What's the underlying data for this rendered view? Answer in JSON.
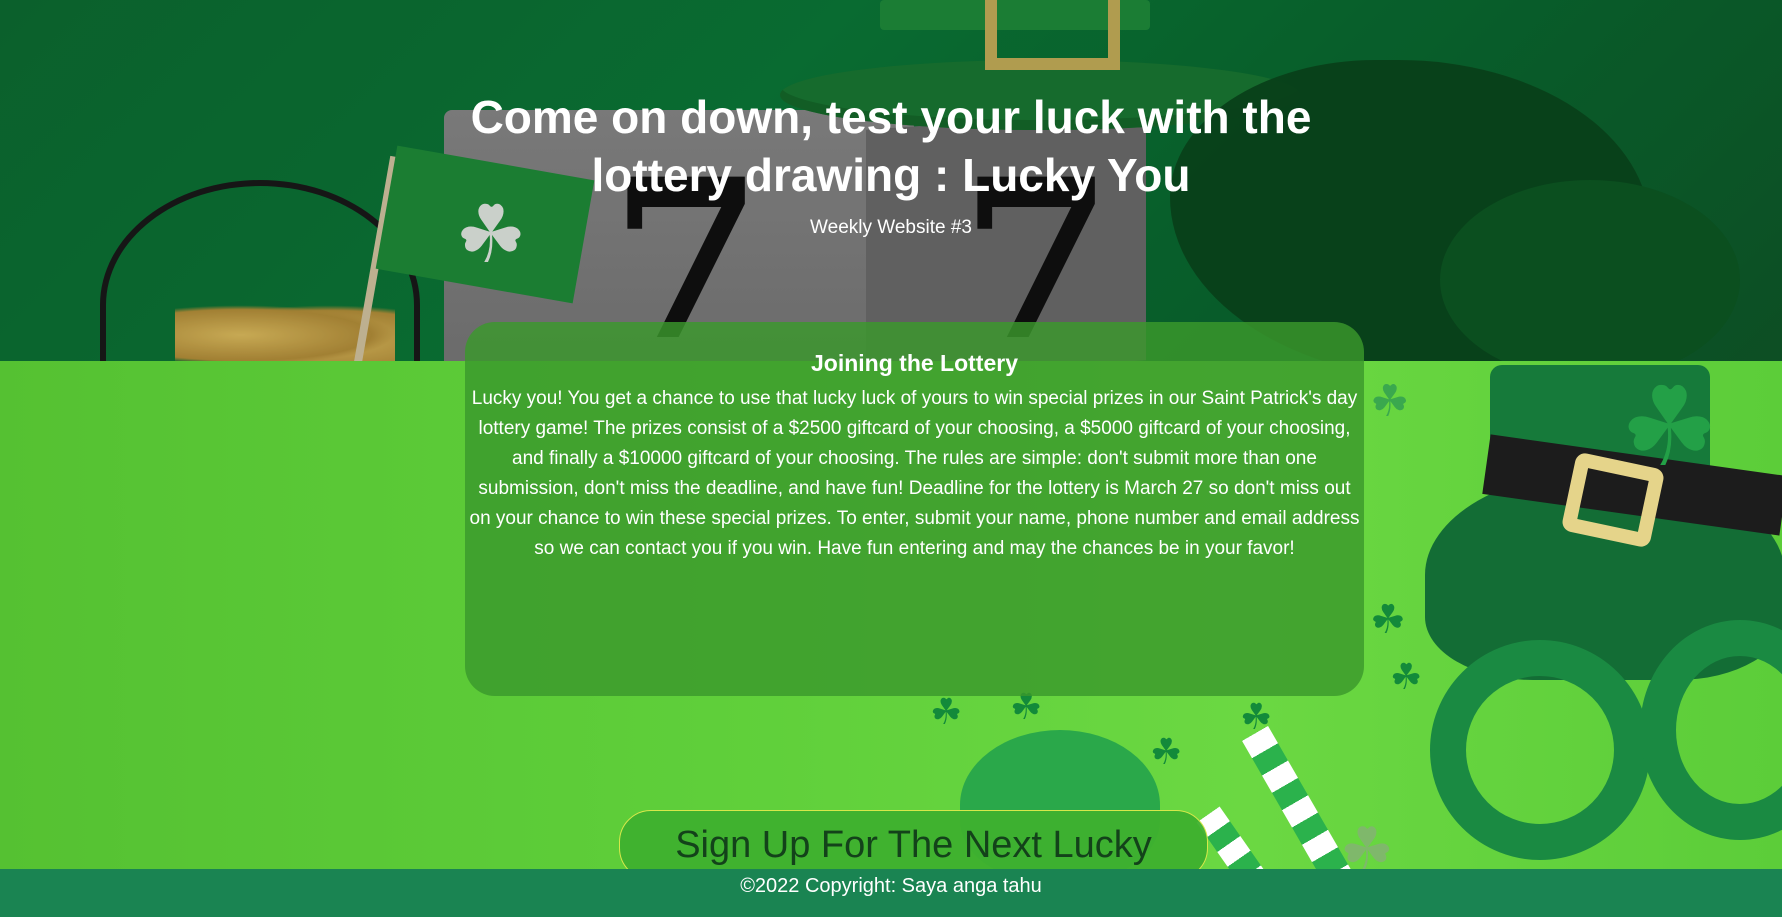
{
  "hero": {
    "title": "Come on down, test your luck with the lottery drawing : Lucky You",
    "subtitle": "Weekly Website #3"
  },
  "card": {
    "heading": "Joining the Lottery",
    "body": "Lucky you! You get a chance to use that lucky luck of yours to win special prizes in our Saint Patrick's day lottery game! The prizes consist of a $2500 giftcard of your choosing, a $5000 giftcard of your choosing, and finally a $10000 giftcard of your choosing. The rules are simple: don't submit more than one submission, don't miss the deadline, and have fun! Deadline for the lottery is March 27 so don't miss out on your chance to win these special prizes. To enter, submit your name, phone number and email address so we can contact you if you win. Have fun entering and may the chances be in your favor!"
  },
  "signup": {
    "label": "Sign Up For The Next Lucky"
  },
  "footer": {
    "text": "©2022 Copyright: Saya anga tahu"
  },
  "colors": {
    "hero_green": "#0d6e33",
    "field_green": "#5fcf3a",
    "card_green": "#3a982c",
    "footer_green": "#1a8452",
    "button_border": "#d6e84a"
  }
}
